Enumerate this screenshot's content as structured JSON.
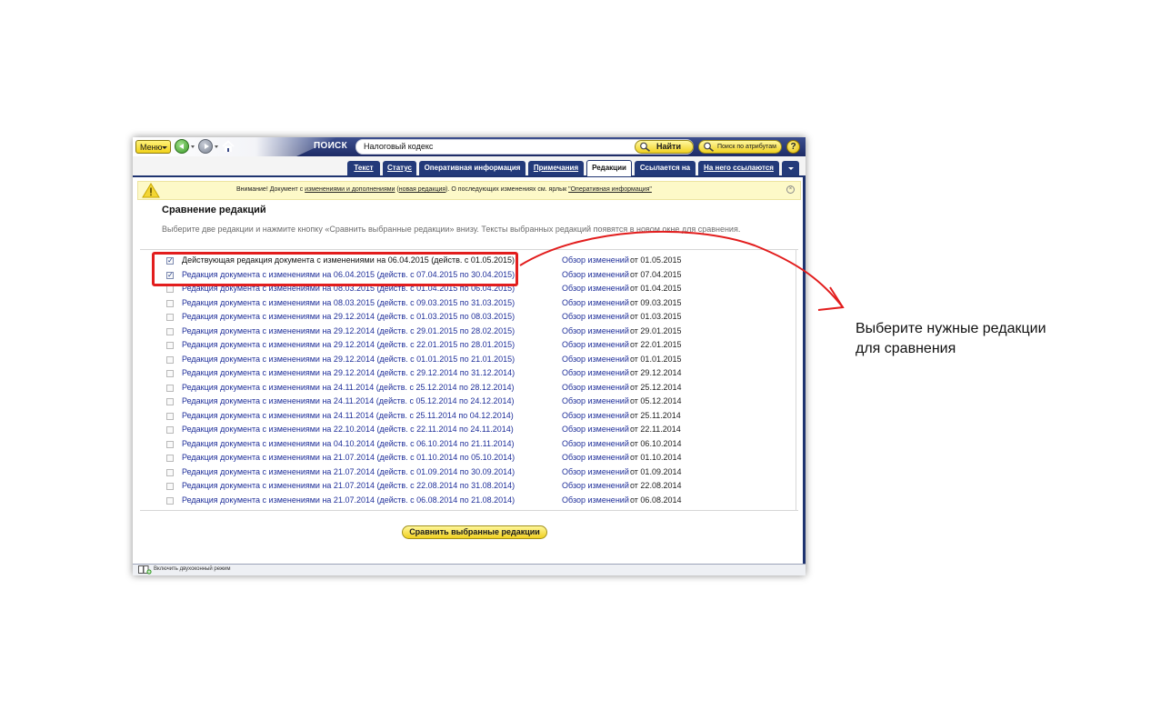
{
  "toolbar": {
    "menu_label": "Меню",
    "search_label": "ПОИСК",
    "search_value": "Налоговый кодекс",
    "find_label": "Найти",
    "attr_search_label": "Поиск по атрибутам",
    "help_label": "?"
  },
  "tabs": [
    {
      "label": "Текст",
      "active": false
    },
    {
      "label": "Статус",
      "active": false
    },
    {
      "label": "Оперативная информация",
      "active": false
    },
    {
      "label": "Примечания",
      "active": false
    },
    {
      "label": "Редакции",
      "active": true
    },
    {
      "label": "Ссылается на",
      "active": false
    },
    {
      "label": "На него ссылаются",
      "active": false
    }
  ],
  "notice": {
    "prefix": "Внимание! Документ с ",
    "link1": "изменениями и дополнениями",
    "mid": " (",
    "link2": "новая редакция",
    "mid2": "). О последующих изменениях см. ярлык ",
    "link3": "\"Оперативная информация\""
  },
  "section": {
    "title": "Сравнение редакций",
    "description": "Выберите две редакции и нажмите кнопку «Сравнить выбранные редакции» внизу. Тексты выбранных редакций появятся в новом окне для сравнения."
  },
  "review_link_label": "Обзор изменений",
  "editions": [
    {
      "title": "Действующая редакция документа с изменениями на 06.04.2015 (действ. с 01.05.2015)",
      "date": "от 01.05.2015",
      "checked": true,
      "current": true
    },
    {
      "title": "Редакция документа с изменениями на 06.04.2015 (действ. с 07.04.2015 по 30.04.2015)",
      "date": "от 07.04.2015",
      "checked": true,
      "current": false
    },
    {
      "title": "Редакция документа с изменениями на 08.03.2015 (действ. с 01.04.2015 по 06.04.2015)",
      "date": "от 01.04.2015",
      "checked": false,
      "current": false
    },
    {
      "title": "Редакция документа с изменениями на 08.03.2015 (действ. с 09.03.2015 по 31.03.2015)",
      "date": "от 09.03.2015",
      "checked": false,
      "current": false
    },
    {
      "title": "Редакция документа с изменениями на 29.12.2014 (действ. с 01.03.2015 по 08.03.2015)",
      "date": "от 01.03.2015",
      "checked": false,
      "current": false
    },
    {
      "title": "Редакция документа с изменениями на 29.12.2014 (действ. с 29.01.2015 по 28.02.2015)",
      "date": "от 29.01.2015",
      "checked": false,
      "current": false
    },
    {
      "title": "Редакция документа с изменениями на 29.12.2014 (действ. с 22.01.2015 по 28.01.2015)",
      "date": "от 22.01.2015",
      "checked": false,
      "current": false
    },
    {
      "title": "Редакция документа с изменениями на 29.12.2014 (действ. с 01.01.2015 по 21.01.2015)",
      "date": "от 01.01.2015",
      "checked": false,
      "current": false
    },
    {
      "title": "Редакция документа с изменениями на 29.12.2014 (действ. с 29.12.2014 по 31.12.2014)",
      "date": "от 29.12.2014",
      "checked": false,
      "current": false
    },
    {
      "title": "Редакция документа с изменениями на 24.11.2014 (действ. с 25.12.2014 по 28.12.2014)",
      "date": "от 25.12.2014",
      "checked": false,
      "current": false
    },
    {
      "title": "Редакция документа с изменениями на 24.11.2014 (действ. с 05.12.2014 по 24.12.2014)",
      "date": "от 05.12.2014",
      "checked": false,
      "current": false
    },
    {
      "title": "Редакция документа с изменениями на 24.11.2014 (действ. с 25.11.2014 по 04.12.2014)",
      "date": "от 25.11.2014",
      "checked": false,
      "current": false
    },
    {
      "title": "Редакция документа с изменениями на 22.10.2014 (действ. с 22.11.2014 по 24.11.2014)",
      "date": "от 22.11.2014",
      "checked": false,
      "current": false
    },
    {
      "title": "Редакция документа с изменениями на 04.10.2014 (действ. с 06.10.2014 по 21.11.2014)",
      "date": "от 06.10.2014",
      "checked": false,
      "current": false
    },
    {
      "title": "Редакция документа с изменениями на 21.07.2014 (действ. с 01.10.2014 по 05.10.2014)",
      "date": "от 01.10.2014",
      "checked": false,
      "current": false
    },
    {
      "title": "Редакция документа с изменениями на 21.07.2014 (действ. с 01.09.2014 по 30.09.2014)",
      "date": "от 01.09.2014",
      "checked": false,
      "current": false
    },
    {
      "title": "Редакция документа с изменениями на 21.07.2014 (действ. с 22.08.2014 по 31.08.2014)",
      "date": "от 22.08.2014",
      "checked": false,
      "current": false
    },
    {
      "title": "Редакция документа с изменениями на 21.07.2014 (действ. с 06.08.2014 по 21.08.2014)",
      "date": "от 06.08.2014",
      "checked": false,
      "current": false
    }
  ],
  "compare_button_label": "Сравнить выбранные редакции",
  "status_bar": {
    "dual_window_label": "Включить двухоконный режим"
  },
  "annotation": {
    "line1": "Выберите нужные редакции",
    "line2": "для сравнения"
  },
  "colors": {
    "highlight": "#e21d1d",
    "link": "#1f2f9a",
    "toolbar_navy": "#1f3470",
    "button_yellow": "#f0d020"
  }
}
